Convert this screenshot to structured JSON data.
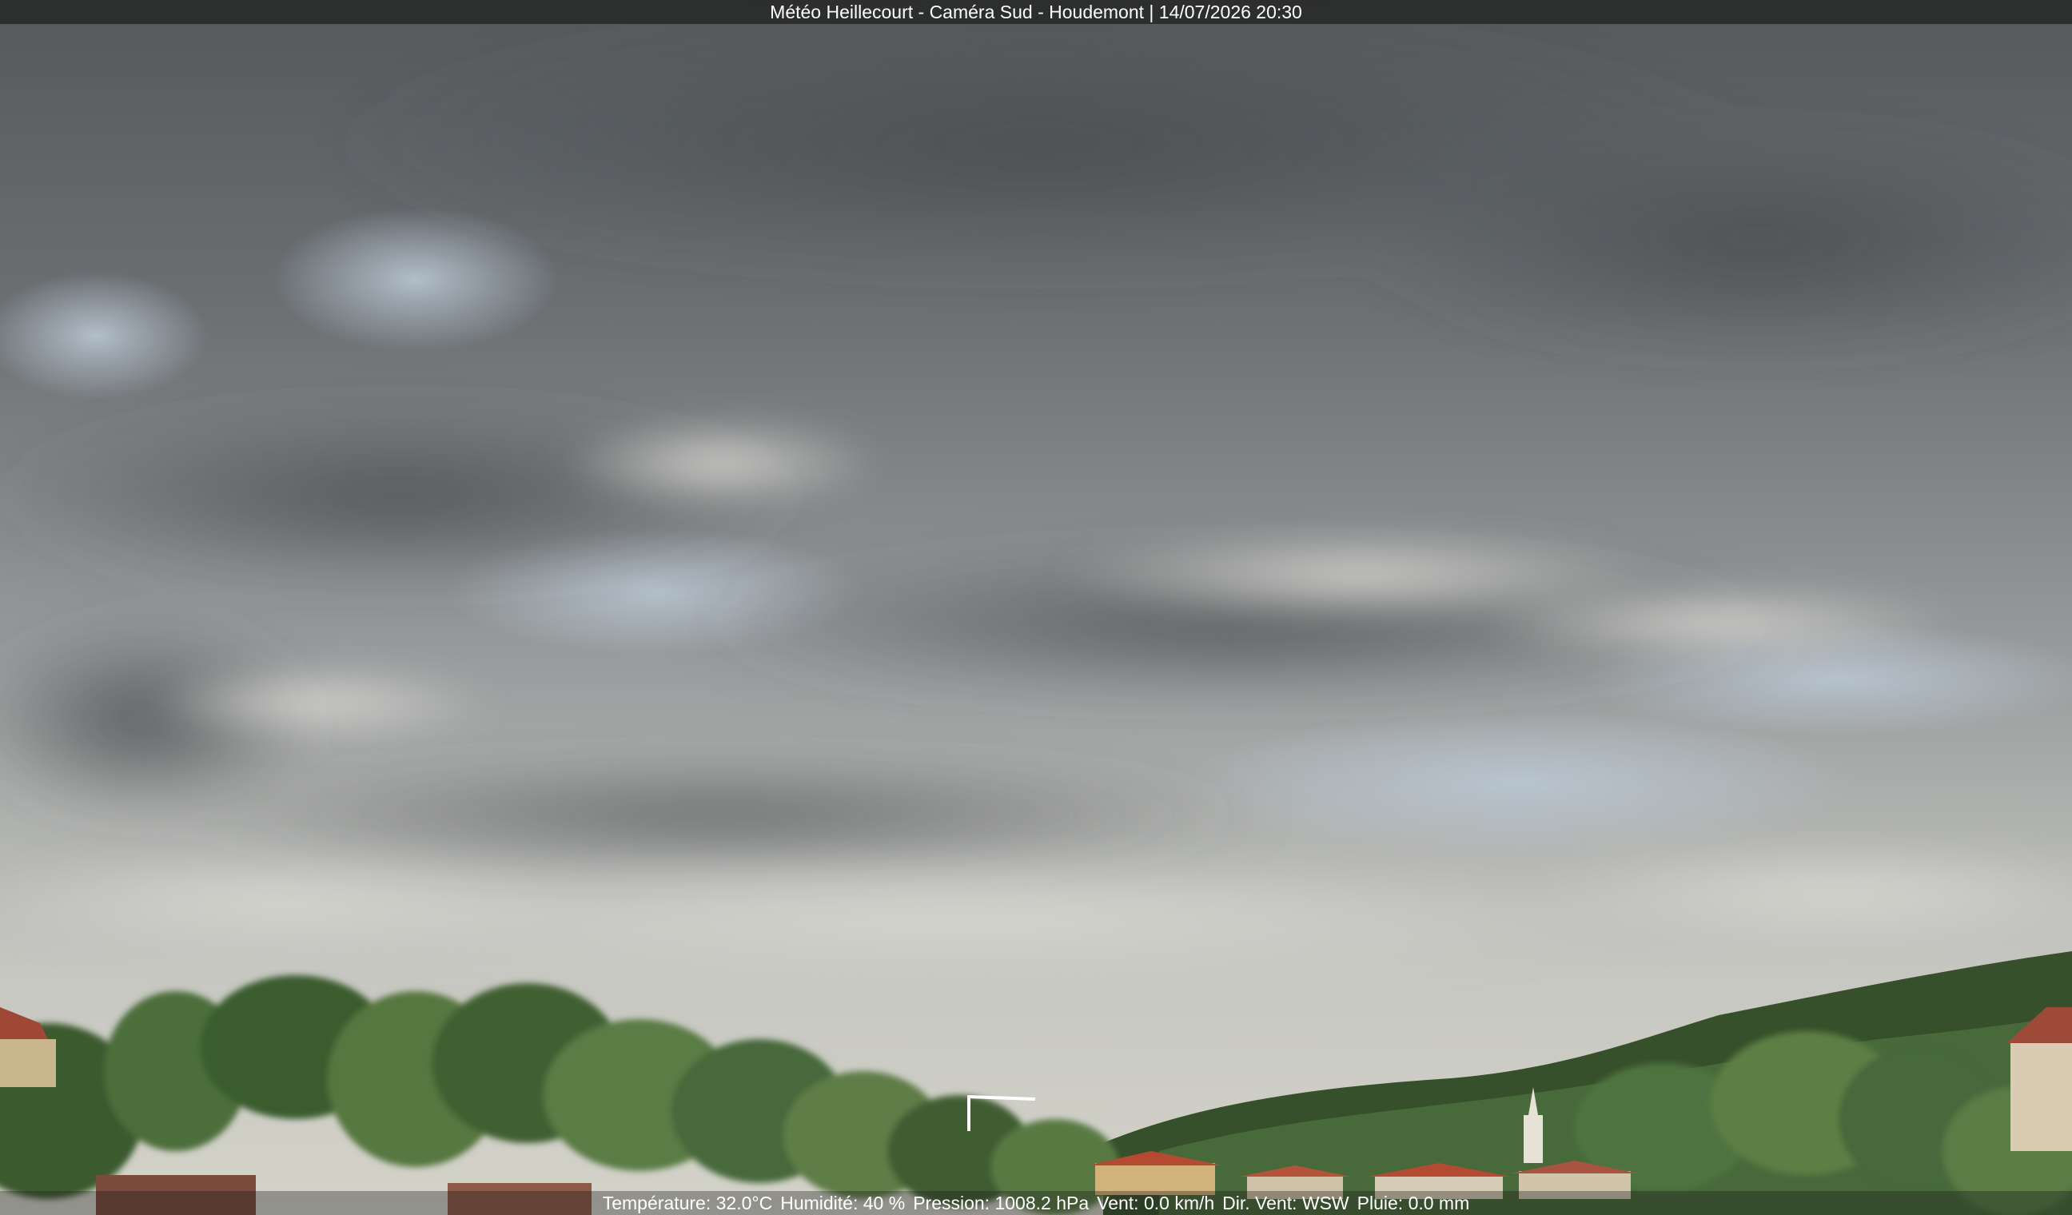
{
  "overlay": {
    "title": "Météo Heillecourt - Caméra Sud - Houdemont | 14/07/2026 20:30"
  },
  "weather": {
    "temperature": "Température: 32.0°C",
    "humidity": "Humidité: 40 %",
    "pressure": "Pression: 1008.2 hPa",
    "wind": "Vent: 0.0 km/h",
    "wind_direction": "Dir. Vent: WSW",
    "rain": "Pluie: 0.0 mm"
  },
  "scene": {
    "subject": "webcam view of an overcast evening sky over a wooded hillside and village rooftops",
    "colors": {
      "sky_top": "#5f6366",
      "sky_mid": "#8f9396",
      "sky_horizon": "#cfcfc6",
      "trees_dark": "#2f4a22",
      "trees_light": "#5d7a3a",
      "roof": "#b44a32",
      "overlay_bar": "#2a2a2a"
    }
  }
}
